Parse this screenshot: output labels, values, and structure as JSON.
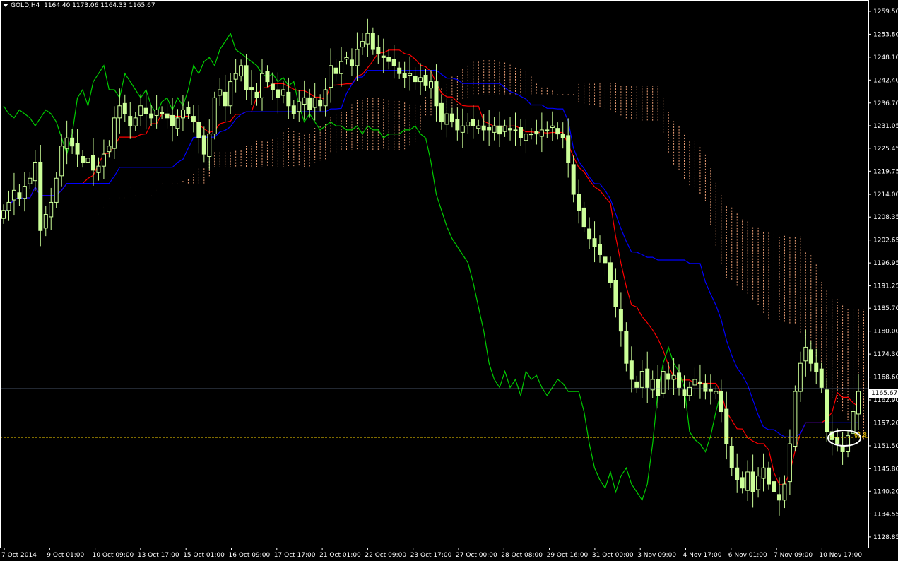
{
  "header": {
    "symbol": "GOLD,H4",
    "ohlc": "1164.40 1173.06 1164.33 1165.67"
  },
  "price_axis": {
    "labels": [
      "1259.50",
      "1253.80",
      "1248.10",
      "1242.40",
      "1236.70",
      "1231.05",
      "1225.45",
      "1219.75",
      "1214.00",
      "1208.35",
      "1202.65",
      "1196.95",
      "1191.25",
      "1185.70",
      "1180.00",
      "1174.30",
      "1168.60",
      "1162.90",
      "1157.20",
      "1151.50",
      "1145.80",
      "1140.20",
      "1134.55",
      "1128.85"
    ],
    "current_price": "1165.67",
    "fib_label": "61.8"
  },
  "time_axis": {
    "labels": [
      "7 Oct 2014",
      "9 Oct 01:00",
      "10 Oct 09:00",
      "13 Oct 17:00",
      "15 Oct 01:00",
      "16 Oct 09:00",
      "17 Oct 17:00",
      "21 Oct 01:00",
      "22 Oct 09:00",
      "23 Oct 17:00",
      "27 Oct 00:00",
      "28 Oct 08:00",
      "29 Oct 16:00",
      "31 Oct 00:00",
      "3 Nov 09:00",
      "4 Nov 17:00",
      "6 Nov 01:00",
      "7 Nov 09:00",
      "10 Nov 17:00"
    ]
  },
  "colors": {
    "background": "#000000",
    "candle": "#ccff99",
    "tenkan": "#ff0000",
    "kijun": "#0000ff",
    "chikou": "#00cc00",
    "cloud": "#f5a57a",
    "price_line": "#8aa0c8",
    "fib_line": "#ffd700",
    "annotation": "#ffffff"
  },
  "chart_data": {
    "type": "candlestick",
    "indicator": "Ichimoku",
    "ylim": [
      1128.85,
      1259.5
    ],
    "close": [
      1210,
      1212,
      1215,
      1213,
      1216,
      1218,
      1222,
      1205,
      1209,
      1212,
      1218,
      1226,
      1228,
      1226,
      1224,
      1222,
      1223,
      1220,
      1221,
      1224,
      1226,
      1233,
      1236,
      1234,
      1231,
      1233,
      1236,
      1234,
      1233,
      1235,
      1234,
      1233,
      1231,
      1233,
      1235,
      1234,
      1232,
      1228,
      1224,
      1229,
      1238,
      1240,
      1236,
      1242,
      1244,
      1246,
      1240,
      1240,
      1238,
      1244,
      1242,
      1240,
      1238,
      1240,
      1236,
      1234,
      1237,
      1238,
      1235,
      1238,
      1236,
      1240,
      1246,
      1244,
      1247,
      1248,
      1246,
      1250,
      1252,
      1254,
      1250,
      1249,
      1248,
      1247,
      1246,
      1244,
      1243,
      1244,
      1242,
      1243,
      1241,
      1242,
      1236,
      1232,
      1234,
      1232,
      1230,
      1231,
      1232,
      1231,
      1231,
      1230,
      1230,
      1231,
      1229,
      1231,
      1230,
      1230,
      1228,
      1229,
      1229,
      1229,
      1230,
      1230,
      1231,
      1229,
      1228,
      1222,
      1214,
      1210,
      1206,
      1203,
      1201,
      1199,
      1197,
      1192,
      1186,
      1180,
      1172,
      1168,
      1166,
      1170,
      1166,
      1168,
      1164,
      1170,
      1168,
      1169,
      1166,
      1164,
      1166,
      1168,
      1167,
      1165,
      1165,
      1165,
      1160,
      1152,
      1146,
      1143,
      1141,
      1145,
      1140,
      1144,
      1146,
      1142,
      1140,
      1138,
      1142,
      1152,
      1165,
      1172,
      1176,
      1172,
      1170,
      1166,
      1155,
      1153,
      1152,
      1150,
      1154,
      1160,
      1165
    ]
  }
}
